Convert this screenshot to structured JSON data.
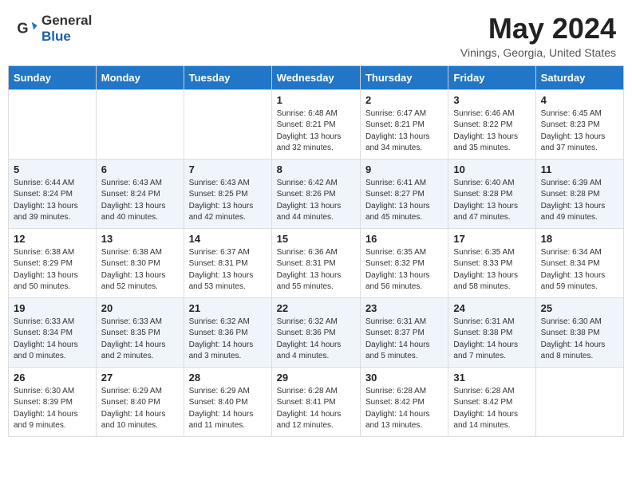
{
  "header": {
    "logo_general": "General",
    "logo_blue": "Blue",
    "month_title": "May 2024",
    "location": "Vinings, Georgia, United States"
  },
  "days_of_week": [
    "Sunday",
    "Monday",
    "Tuesday",
    "Wednesday",
    "Thursday",
    "Friday",
    "Saturday"
  ],
  "weeks": [
    [
      {
        "day": "",
        "info": ""
      },
      {
        "day": "",
        "info": ""
      },
      {
        "day": "",
        "info": ""
      },
      {
        "day": "1",
        "info": "Sunrise: 6:48 AM\nSunset: 8:21 PM\nDaylight: 13 hours\nand 32 minutes."
      },
      {
        "day": "2",
        "info": "Sunrise: 6:47 AM\nSunset: 8:21 PM\nDaylight: 13 hours\nand 34 minutes."
      },
      {
        "day": "3",
        "info": "Sunrise: 6:46 AM\nSunset: 8:22 PM\nDaylight: 13 hours\nand 35 minutes."
      },
      {
        "day": "4",
        "info": "Sunrise: 6:45 AM\nSunset: 8:23 PM\nDaylight: 13 hours\nand 37 minutes."
      }
    ],
    [
      {
        "day": "5",
        "info": "Sunrise: 6:44 AM\nSunset: 8:24 PM\nDaylight: 13 hours\nand 39 minutes."
      },
      {
        "day": "6",
        "info": "Sunrise: 6:43 AM\nSunset: 8:24 PM\nDaylight: 13 hours\nand 40 minutes."
      },
      {
        "day": "7",
        "info": "Sunrise: 6:43 AM\nSunset: 8:25 PM\nDaylight: 13 hours\nand 42 minutes."
      },
      {
        "day": "8",
        "info": "Sunrise: 6:42 AM\nSunset: 8:26 PM\nDaylight: 13 hours\nand 44 minutes."
      },
      {
        "day": "9",
        "info": "Sunrise: 6:41 AM\nSunset: 8:27 PM\nDaylight: 13 hours\nand 45 minutes."
      },
      {
        "day": "10",
        "info": "Sunrise: 6:40 AM\nSunset: 8:28 PM\nDaylight: 13 hours\nand 47 minutes."
      },
      {
        "day": "11",
        "info": "Sunrise: 6:39 AM\nSunset: 8:28 PM\nDaylight: 13 hours\nand 49 minutes."
      }
    ],
    [
      {
        "day": "12",
        "info": "Sunrise: 6:38 AM\nSunset: 8:29 PM\nDaylight: 13 hours\nand 50 minutes."
      },
      {
        "day": "13",
        "info": "Sunrise: 6:38 AM\nSunset: 8:30 PM\nDaylight: 13 hours\nand 52 minutes."
      },
      {
        "day": "14",
        "info": "Sunrise: 6:37 AM\nSunset: 8:31 PM\nDaylight: 13 hours\nand 53 minutes."
      },
      {
        "day": "15",
        "info": "Sunrise: 6:36 AM\nSunset: 8:31 PM\nDaylight: 13 hours\nand 55 minutes."
      },
      {
        "day": "16",
        "info": "Sunrise: 6:35 AM\nSunset: 8:32 PM\nDaylight: 13 hours\nand 56 minutes."
      },
      {
        "day": "17",
        "info": "Sunrise: 6:35 AM\nSunset: 8:33 PM\nDaylight: 13 hours\nand 58 minutes."
      },
      {
        "day": "18",
        "info": "Sunrise: 6:34 AM\nSunset: 8:34 PM\nDaylight: 13 hours\nand 59 minutes."
      }
    ],
    [
      {
        "day": "19",
        "info": "Sunrise: 6:33 AM\nSunset: 8:34 PM\nDaylight: 14 hours\nand 0 minutes."
      },
      {
        "day": "20",
        "info": "Sunrise: 6:33 AM\nSunset: 8:35 PM\nDaylight: 14 hours\nand 2 minutes."
      },
      {
        "day": "21",
        "info": "Sunrise: 6:32 AM\nSunset: 8:36 PM\nDaylight: 14 hours\nand 3 minutes."
      },
      {
        "day": "22",
        "info": "Sunrise: 6:32 AM\nSunset: 8:36 PM\nDaylight: 14 hours\nand 4 minutes."
      },
      {
        "day": "23",
        "info": "Sunrise: 6:31 AM\nSunset: 8:37 PM\nDaylight: 14 hours\nand 5 minutes."
      },
      {
        "day": "24",
        "info": "Sunrise: 6:31 AM\nSunset: 8:38 PM\nDaylight: 14 hours\nand 7 minutes."
      },
      {
        "day": "25",
        "info": "Sunrise: 6:30 AM\nSunset: 8:38 PM\nDaylight: 14 hours\nand 8 minutes."
      }
    ],
    [
      {
        "day": "26",
        "info": "Sunrise: 6:30 AM\nSunset: 8:39 PM\nDaylight: 14 hours\nand 9 minutes."
      },
      {
        "day": "27",
        "info": "Sunrise: 6:29 AM\nSunset: 8:40 PM\nDaylight: 14 hours\nand 10 minutes."
      },
      {
        "day": "28",
        "info": "Sunrise: 6:29 AM\nSunset: 8:40 PM\nDaylight: 14 hours\nand 11 minutes."
      },
      {
        "day": "29",
        "info": "Sunrise: 6:28 AM\nSunset: 8:41 PM\nDaylight: 14 hours\nand 12 minutes."
      },
      {
        "day": "30",
        "info": "Sunrise: 6:28 AM\nSunset: 8:42 PM\nDaylight: 14 hours\nand 13 minutes."
      },
      {
        "day": "31",
        "info": "Sunrise: 6:28 AM\nSunset: 8:42 PM\nDaylight: 14 hours\nand 14 minutes."
      },
      {
        "day": "",
        "info": ""
      }
    ]
  ]
}
